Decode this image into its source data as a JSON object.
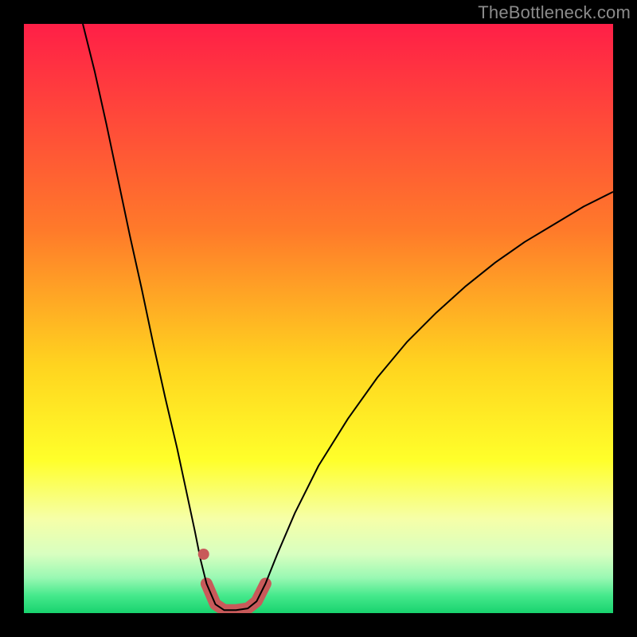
{
  "watermark": "TheBottleneck.com",
  "chart_data": {
    "type": "line",
    "title": "",
    "xlabel": "",
    "ylabel": "",
    "xlim": [
      0,
      100
    ],
    "ylim": [
      0,
      100
    ],
    "background_gradient": {
      "stops": [
        {
          "offset": 0.0,
          "color": "#ff1f47"
        },
        {
          "offset": 0.35,
          "color": "#ff7a2a"
        },
        {
          "offset": 0.58,
          "color": "#ffd41f"
        },
        {
          "offset": 0.74,
          "color": "#ffff2a"
        },
        {
          "offset": 0.84,
          "color": "#f6ffa8"
        },
        {
          "offset": 0.9,
          "color": "#d8ffc0"
        },
        {
          "offset": 0.94,
          "color": "#99f8b3"
        },
        {
          "offset": 0.97,
          "color": "#46e98c"
        },
        {
          "offset": 1.0,
          "color": "#18d36e"
        }
      ]
    },
    "series": [
      {
        "name": "bottleneck-curve",
        "stroke": "#000000",
        "stroke_width": 2,
        "points": [
          {
            "x": 10.0,
            "y": 100.0
          },
          {
            "x": 12.0,
            "y": 92.0
          },
          {
            "x": 14.0,
            "y": 83.0
          },
          {
            "x": 16.0,
            "y": 73.5
          },
          {
            "x": 18.0,
            "y": 64.0
          },
          {
            "x": 20.0,
            "y": 55.0
          },
          {
            "x": 22.0,
            "y": 45.5
          },
          {
            "x": 24.0,
            "y": 36.5
          },
          {
            "x": 26.0,
            "y": 28.0
          },
          {
            "x": 27.5,
            "y": 21.0
          },
          {
            "x": 29.0,
            "y": 14.0
          },
          {
            "x": 30.0,
            "y": 9.0
          },
          {
            "x": 31.0,
            "y": 5.0
          },
          {
            "x": 32.5,
            "y": 1.5
          },
          {
            "x": 34.0,
            "y": 0.5
          },
          {
            "x": 36.0,
            "y": 0.5
          },
          {
            "x": 38.0,
            "y": 0.8
          },
          {
            "x": 39.5,
            "y": 2.0
          },
          {
            "x": 41.0,
            "y": 5.0
          },
          {
            "x": 43.0,
            "y": 10.0
          },
          {
            "x": 46.0,
            "y": 17.0
          },
          {
            "x": 50.0,
            "y": 25.0
          },
          {
            "x": 55.0,
            "y": 33.0
          },
          {
            "x": 60.0,
            "y": 40.0
          },
          {
            "x": 65.0,
            "y": 46.0
          },
          {
            "x": 70.0,
            "y": 51.0
          },
          {
            "x": 75.0,
            "y": 55.5
          },
          {
            "x": 80.0,
            "y": 59.5
          },
          {
            "x": 85.0,
            "y": 63.0
          },
          {
            "x": 90.0,
            "y": 66.0
          },
          {
            "x": 95.0,
            "y": 69.0
          },
          {
            "x": 100.0,
            "y": 71.5
          }
        ]
      },
      {
        "name": "optimal-band",
        "stroke": "#c85a5a",
        "stroke_width": 15,
        "linecap": "round",
        "points": [
          {
            "x": 31.0,
            "y": 5.0
          },
          {
            "x": 32.5,
            "y": 1.5
          },
          {
            "x": 34.0,
            "y": 0.5
          },
          {
            "x": 36.0,
            "y": 0.5
          },
          {
            "x": 38.0,
            "y": 0.8
          },
          {
            "x": 39.5,
            "y": 2.0
          },
          {
            "x": 41.0,
            "y": 5.0
          }
        ]
      }
    ],
    "markers": [
      {
        "name": "highlight-dot",
        "x": 30.5,
        "y": 10.0,
        "r": 7,
        "fill": "#c85a5a"
      }
    ]
  }
}
